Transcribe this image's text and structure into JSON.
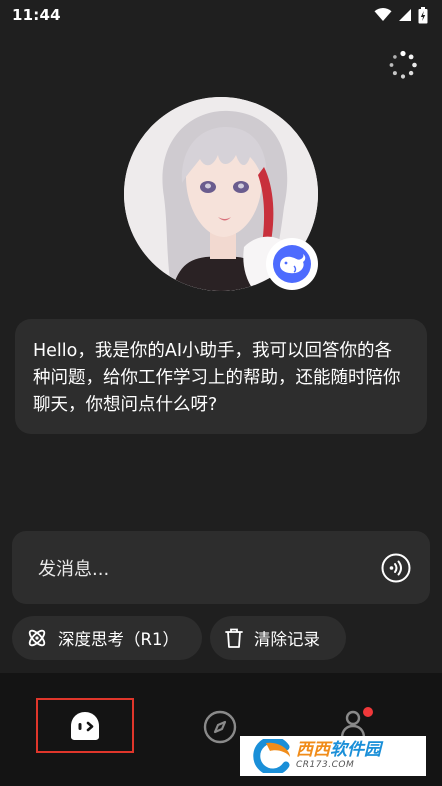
{
  "status_bar": {
    "time": "11:44",
    "icons": [
      "wifi-icon",
      "signal-icon",
      "battery-charging-icon"
    ]
  },
  "header": {
    "loading_icon": "spinner-icon"
  },
  "assistant": {
    "avatar_icon": "anime-girl-avatar",
    "badge_icon": "deepseek-whale-icon",
    "greeting": "Hello，我是你的AI小助手，我可以回答你的各种问题，给你工作学习上的帮助，还能随时陪你聊天，你想问点什么呀?"
  },
  "composer": {
    "placeholder": "发消息...",
    "voice_icon": "voice-wave-icon"
  },
  "actions": {
    "deep_think_label": "深度思考（R1）",
    "clear_label": "清除记录"
  },
  "tab_bar": {
    "tabs": [
      {
        "icon": "home-ghost-icon",
        "selected": true
      },
      {
        "icon": "compass-icon",
        "selected": false
      },
      {
        "icon": "profile-icon",
        "selected": false,
        "badge": true
      }
    ],
    "accent": "#e0362b"
  },
  "watermark": {
    "name_a": "西西",
    "name_b": "软件园",
    "url": "CR173.COM"
  },
  "colors": {
    "background": "#1f1f1f",
    "surface": "#2d2d2d",
    "tab_bar": "#141414",
    "badge_dot": "#f0383a",
    "deepseek_blue": "#4d6bfe"
  }
}
